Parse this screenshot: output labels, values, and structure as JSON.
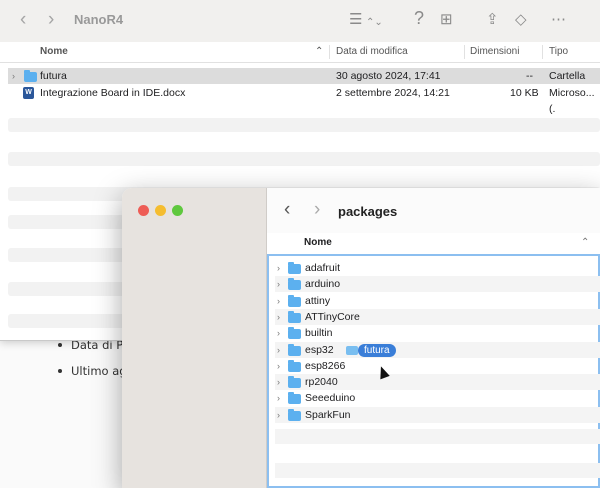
{
  "doc": {
    "bullets": [
      "Data di Pu",
      "Ultimo ag"
    ]
  },
  "back_window": {
    "title": "NanoR4",
    "nav_back": "‹",
    "nav_forward": "›",
    "toolbar_icons": {
      "list": "☰",
      "question": "?",
      "grid": "⊞",
      "share": "⇪",
      "tag": "◇",
      "more": "⋯"
    },
    "columns": {
      "name": "Nome",
      "modified": "Data di modifica",
      "size": "Dimensioni",
      "kind": "Tipo"
    },
    "rows": [
      {
        "name": "futura",
        "modified": "30 agosto 2024, 17:41",
        "size": "--",
        "kind": "Cartella"
      },
      {
        "name": "Integrazione Board in IDE.docx",
        "modified": "2 settembre 2024, 14:21",
        "size": "10 KB",
        "kind": "Microso...(."
      }
    ]
  },
  "front_window": {
    "title": "packages",
    "nav_back": "‹",
    "nav_forward": "›",
    "column_name": "Nome",
    "folders": [
      "adafruit",
      "arduino",
      "attiny",
      "ATTinyCore",
      "builtin",
      "esp32",
      "esp8266",
      "rp2040",
      "Seeeduino",
      "SparkFun"
    ]
  },
  "drag": {
    "label": "futura"
  },
  "colors": {
    "folder": "#5cb0ef",
    "selection": "#3a7ed8",
    "close": "#ee5d56",
    "minimize": "#f5bd30",
    "zoom": "#5fc83e"
  }
}
